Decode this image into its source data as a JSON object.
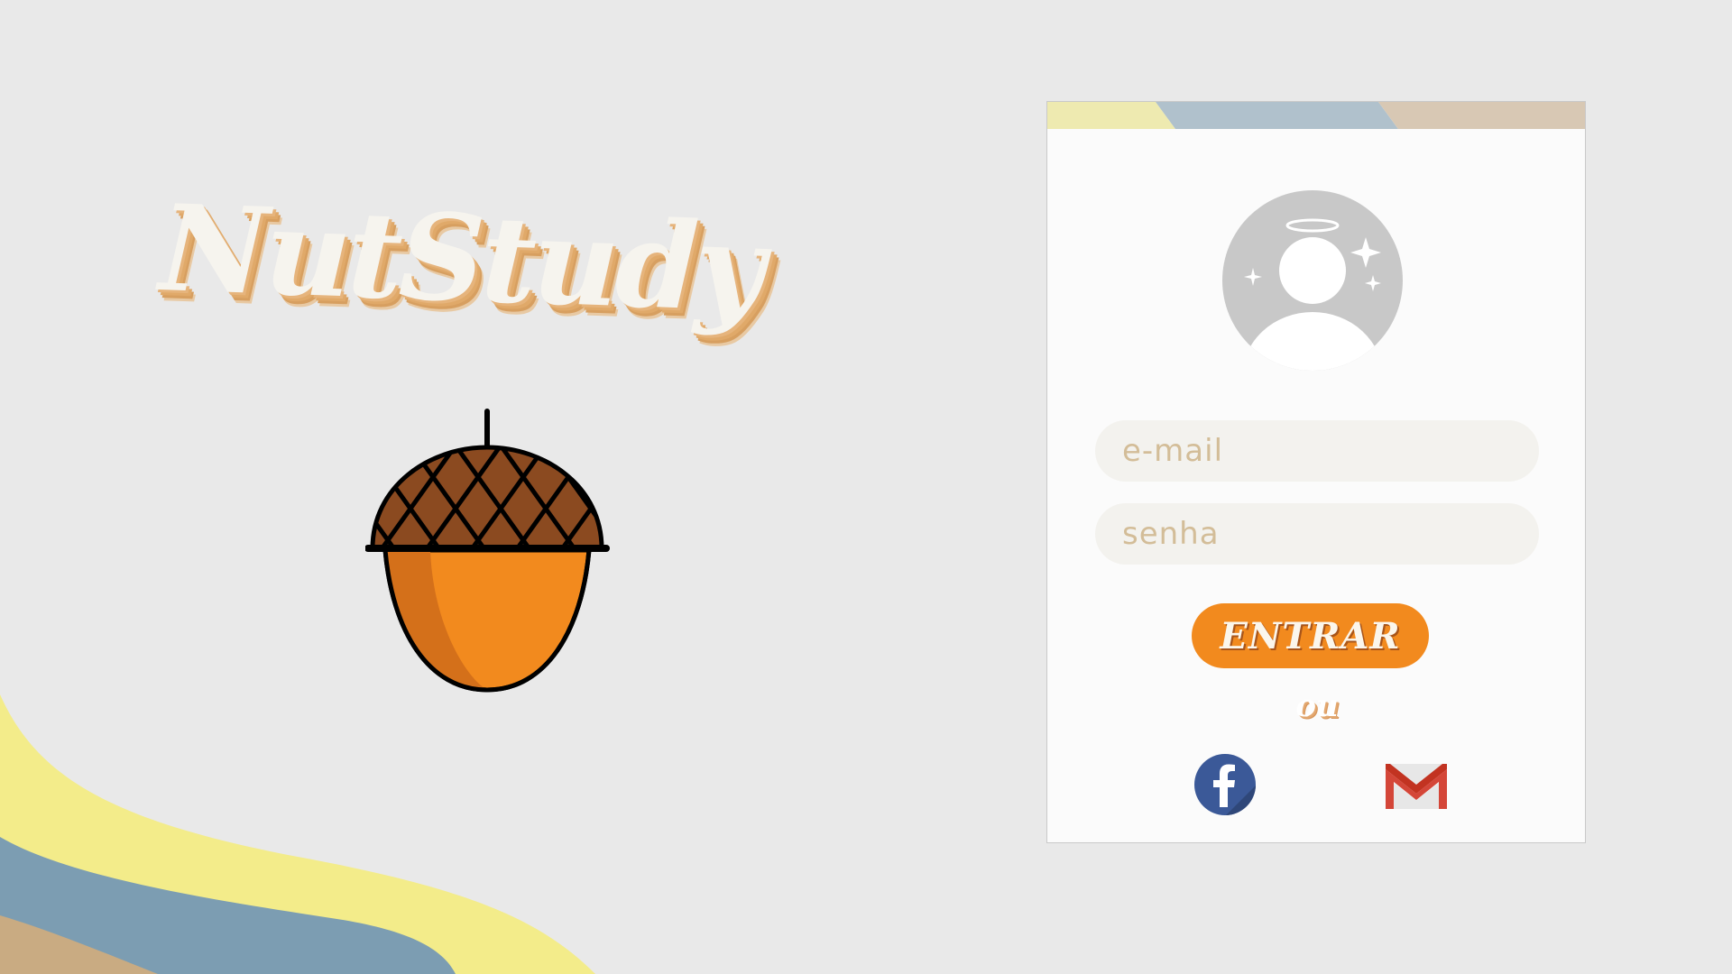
{
  "brand": {
    "title": "NutStudy"
  },
  "login": {
    "email_placeholder": "e-mail",
    "password_placeholder": "senha",
    "submit_label": "ENTRAR",
    "divider_text": "ou",
    "social": [
      {
        "name": "facebook",
        "icon": "facebook-icon"
      },
      {
        "name": "gmail",
        "icon": "gmail-icon"
      }
    ]
  },
  "colors": {
    "background": "#e9e9e9",
    "accent_orange": "#f28a1e",
    "brand_cream": "#f6f4ee",
    "brand_shadow": "#e0a969",
    "wave_yellow": "#f3ec8a",
    "wave_blue": "#7c9db2",
    "wave_tan": "#c9ab82",
    "stripe_yellow": "#eeeab0",
    "stripe_blue": "#b0c1cc",
    "stripe_tan": "#d8c8b4",
    "facebook_blue": "#3b5998",
    "gmail_red": "#d44638"
  }
}
